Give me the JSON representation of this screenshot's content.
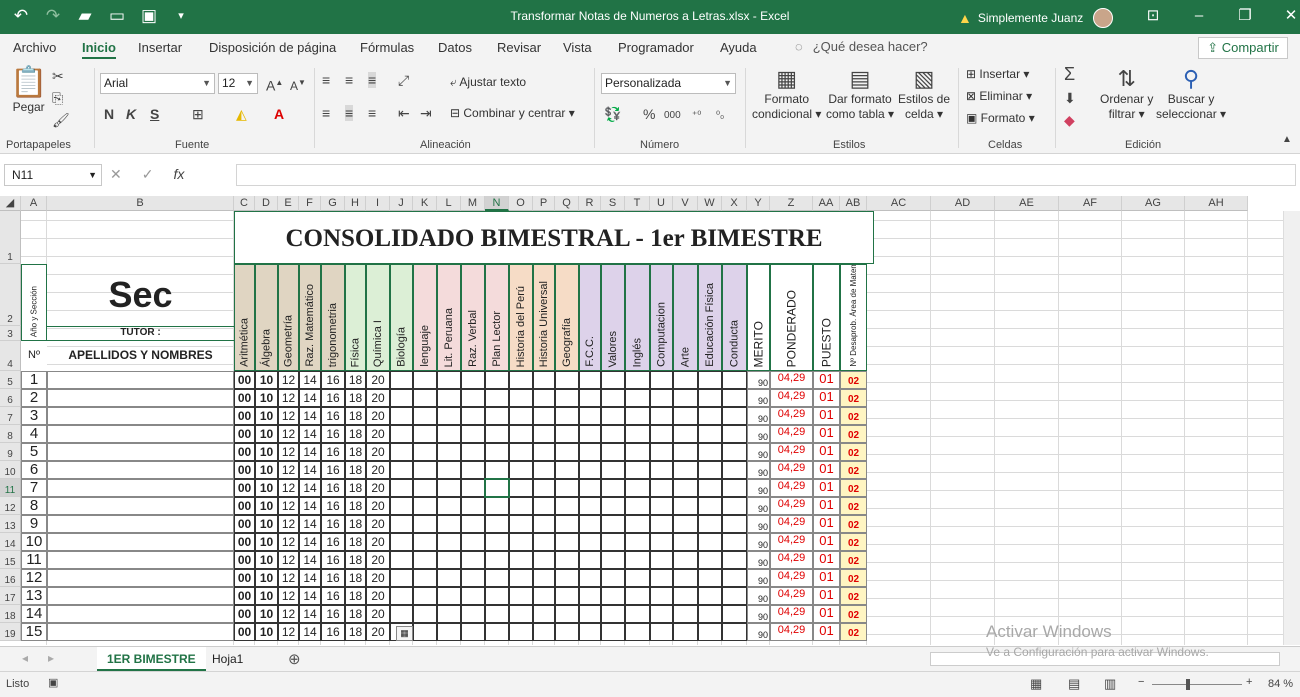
{
  "window": {
    "title": "Transformar Notas de Numeros a Letras.xlsx  -  Excel",
    "user": "Simplemente Juanz"
  },
  "menu": [
    "Archivo",
    "Inicio",
    "Insertar",
    "Disposición de página",
    "Fórmulas",
    "Datos",
    "Revisar",
    "Vista",
    "Programador",
    "Ayuda"
  ],
  "tell_me": "¿Qué desea hacer?",
  "share": "Compartir",
  "ribbon": {
    "paste": "Pegar",
    "font_name": "Arial",
    "font_size": "12",
    "wrap_text": "Ajustar texto",
    "merge_center": "Combinar y centrar",
    "number_format": "Personalizada",
    "cond_format_1": "Formato",
    "cond_format_2": "condicional",
    "format_table_1": "Dar formato",
    "format_table_2": "como tabla",
    "cell_styles_1": "Estilos de",
    "cell_styles_2": "celda",
    "insert": "Insertar",
    "delete": "Eliminar",
    "format": "Formato",
    "sort_1": "Ordenar y",
    "sort_2": "filtrar",
    "find_1": "Buscar y",
    "find_2": "seleccionar",
    "groups": [
      "Portapapeles",
      "Fuente",
      "Alineación",
      "Número",
      "Estilos",
      "Celdas",
      "Edición"
    ]
  },
  "name_box": "N11",
  "columns": [
    "A",
    "B",
    "C",
    "D",
    "E",
    "F",
    "G",
    "H",
    "I",
    "J",
    "K",
    "L",
    "M",
    "N",
    "O",
    "P",
    "Q",
    "R",
    "S",
    "T",
    "U",
    "V",
    "W",
    "X",
    "Y",
    "Z",
    "AA",
    "AB",
    "AC",
    "AD",
    "AE",
    "AF",
    "AG",
    "AH"
  ],
  "rows": [
    "1",
    "2",
    "3",
    "4",
    "5",
    "6",
    "7",
    "8",
    "9",
    "10",
    "11",
    "12",
    "13",
    "14",
    "15",
    "16",
    "17",
    "18",
    "19"
  ],
  "sheet": {
    "banner": "CONSOLIDADO BIMESTRAL - 1er BIMESTRE",
    "sec": "Sec",
    "tutor": "TUTOR :",
    "anio_seccion": "Año y Sección",
    "no_label": "Nº",
    "names_header": "APELLIDOS Y NOMBRES",
    "subjects": [
      "Aritmética",
      "Álgebra",
      "Geometría",
      "Raz. Matemático",
      "trigonometria",
      "Física",
      "Química I",
      "Biología",
      "lenguaje",
      "Lit. Peruana",
      "Raz. Verbal",
      "Plan  Lector",
      "Historia del Perú",
      "Historia Universal",
      "Geografía",
      "F.C.C.",
      "Valores",
      "Inglés",
      "Computacion",
      "Arte",
      "Educación Física",
      "Conducta"
    ],
    "summary_headers": [
      "MERITO",
      "PONDERADO",
      "PUESTO",
      "Nº Desaprob. Área de Matemática"
    ],
    "students": [
      {
        "n": "1",
        "g": [
          "00",
          "10",
          "12",
          "14",
          "16",
          "18",
          "20"
        ],
        "merito": "90",
        "ponderado": "04,29",
        "puesto": "01",
        "desap": "02"
      },
      {
        "n": "2",
        "g": [
          "00",
          "10",
          "12",
          "14",
          "16",
          "18",
          "20"
        ],
        "merito": "90",
        "ponderado": "04,29",
        "puesto": "01",
        "desap": "02"
      },
      {
        "n": "3",
        "g": [
          "00",
          "10",
          "12",
          "14",
          "16",
          "18",
          "20"
        ],
        "merito": "90",
        "ponderado": "04,29",
        "puesto": "01",
        "desap": "02"
      },
      {
        "n": "4",
        "g": [
          "00",
          "10",
          "12",
          "14",
          "16",
          "18",
          "20"
        ],
        "merito": "90",
        "ponderado": "04,29",
        "puesto": "01",
        "desap": "02"
      },
      {
        "n": "5",
        "g": [
          "00",
          "10",
          "12",
          "14",
          "16",
          "18",
          "20"
        ],
        "merito": "90",
        "ponderado": "04,29",
        "puesto": "01",
        "desap": "02"
      },
      {
        "n": "6",
        "g": [
          "00",
          "10",
          "12",
          "14",
          "16",
          "18",
          "20"
        ],
        "merito": "90",
        "ponderado": "04,29",
        "puesto": "01",
        "desap": "02"
      },
      {
        "n": "7",
        "g": [
          "00",
          "10",
          "12",
          "14",
          "16",
          "18",
          "20"
        ],
        "merito": "90",
        "ponderado": "04,29",
        "puesto": "01",
        "desap": "02"
      },
      {
        "n": "8",
        "g": [
          "00",
          "10",
          "12",
          "14",
          "16",
          "18",
          "20"
        ],
        "merito": "90",
        "ponderado": "04,29",
        "puesto": "01",
        "desap": "02"
      },
      {
        "n": "9",
        "g": [
          "00",
          "10",
          "12",
          "14",
          "16",
          "18",
          "20"
        ],
        "merito": "90",
        "ponderado": "04,29",
        "puesto": "01",
        "desap": "02"
      },
      {
        "n": "10",
        "g": [
          "00",
          "10",
          "12",
          "14",
          "16",
          "18",
          "20"
        ],
        "merito": "90",
        "ponderado": "04,29",
        "puesto": "01",
        "desap": "02"
      },
      {
        "n": "11",
        "g": [
          "00",
          "10",
          "12",
          "14",
          "16",
          "18",
          "20"
        ],
        "merito": "90",
        "ponderado": "04,29",
        "puesto": "01",
        "desap": "02"
      },
      {
        "n": "12",
        "g": [
          "00",
          "10",
          "12",
          "14",
          "16",
          "18",
          "20"
        ],
        "merito": "90",
        "ponderado": "04,29",
        "puesto": "01",
        "desap": "02"
      },
      {
        "n": "13",
        "g": [
          "00",
          "10",
          "12",
          "14",
          "16",
          "18",
          "20"
        ],
        "merito": "90",
        "ponderado": "04,29",
        "puesto": "01",
        "desap": "02"
      },
      {
        "n": "14",
        "g": [
          "00",
          "10",
          "12",
          "14",
          "16",
          "18",
          "20"
        ],
        "merito": "90",
        "ponderado": "04,29",
        "puesto": "01",
        "desap": "02"
      },
      {
        "n": "15",
        "g": [
          "00",
          "10",
          "12",
          "14",
          "16",
          "18",
          "20"
        ],
        "merito": "90",
        "ponderado": "04,29",
        "puesto": "01",
        "desap": "02"
      }
    ]
  },
  "sheet_tabs": [
    "1ER BIMESTRE",
    "Hoja1"
  ],
  "status": "Listo",
  "zoom": "84 %",
  "watermark": {
    "line1": "Activar Windows",
    "line2": "Ve a Configuración para activar Windows."
  },
  "colors": {
    "excel_green": "#217346",
    "math_tan": "#e0d5c2",
    "science_green": "#dcefd6",
    "language_pink": "#f4dbdb",
    "history_orange": "#f6dcc6",
    "civics_purple": "#ddd2ea",
    "desap_yellow": "#fff5c2",
    "score_red": "#e00000"
  }
}
